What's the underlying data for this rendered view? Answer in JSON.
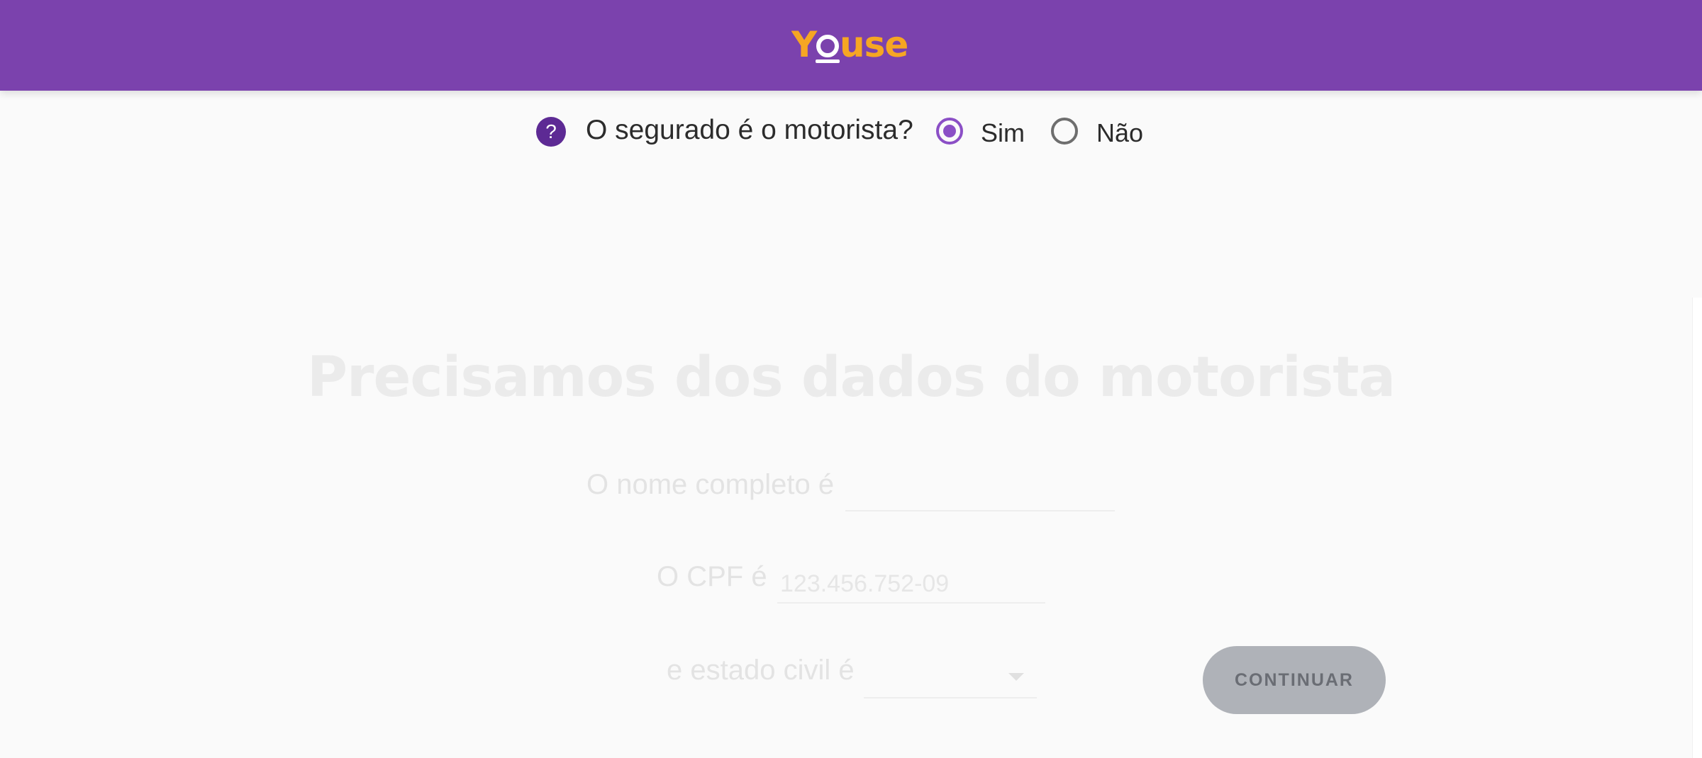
{
  "header": {
    "logo_text": "Youse",
    "logo_color": "#f6a623",
    "background_color": "#7b42ad"
  },
  "question": {
    "help_icon": "?",
    "label": "O segurado é o motorista?",
    "options": [
      {
        "label": "Sim",
        "selected": true
      },
      {
        "label": "Não",
        "selected": false
      }
    ]
  },
  "form": {
    "title": "Precisamos dos dados do motorista",
    "name_label": "O nome completo é",
    "name_value": "",
    "cpf_label": "O CPF é",
    "cpf_placeholder": "123.456.752-09",
    "marital_label": "e estado civil é",
    "marital_value": "",
    "continue_label": "CONTINUAR"
  },
  "colors": {
    "accent": "#8b4fc6",
    "button_disabled": "#afb2b8"
  }
}
